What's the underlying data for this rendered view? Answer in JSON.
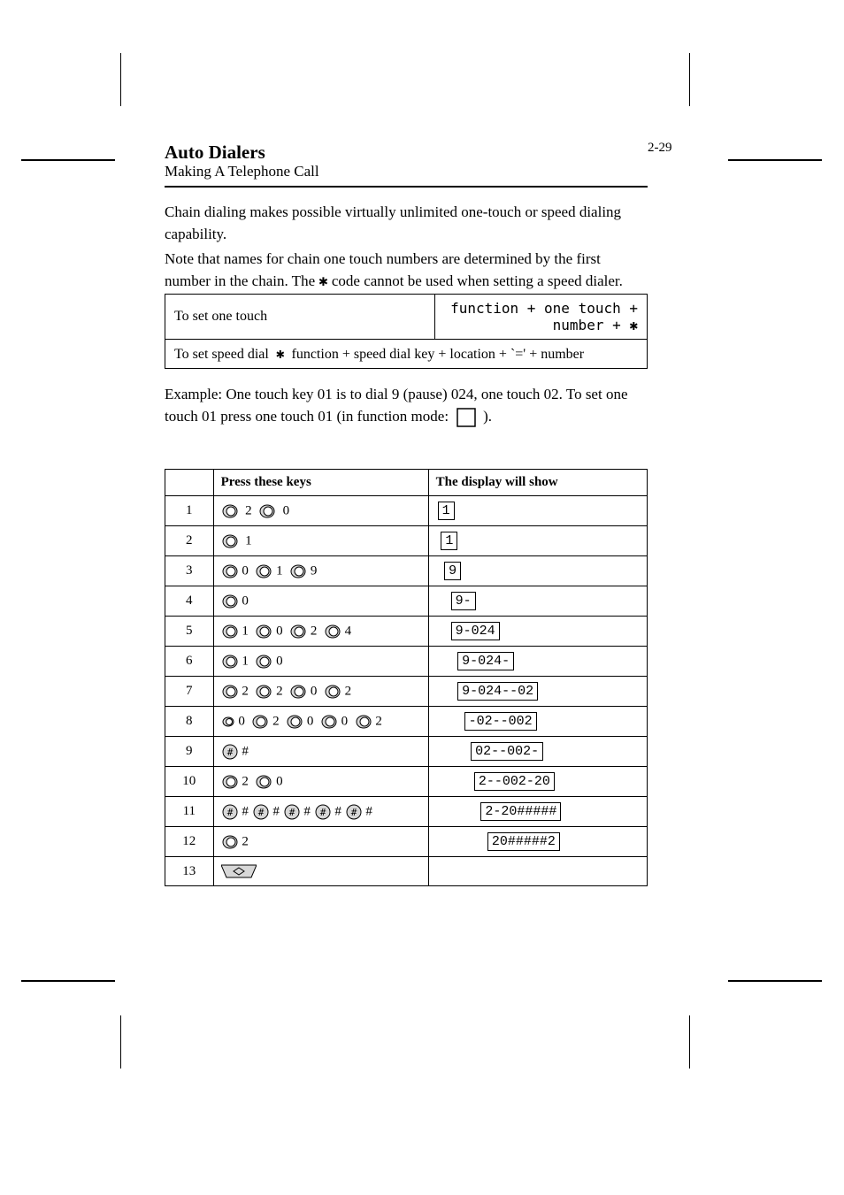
{
  "page_number": "2-29",
  "section": {
    "title": "Auto Dialers",
    "subtitle": "Making A Telephone Call"
  },
  "intro": {
    "p1": "Chain dialing makes possible virtually unlimited one-touch or speed dialing capability.",
    "p2_prefix": "Note that names for chain one touch numbers are determined by the first number in the chain. The ",
    "p2_star": "✱",
    "p2_suffix": " code cannot be used when setting a speed dialer."
  },
  "table1": {
    "r1c1": "To set one touch",
    "r1c2_prefix": "function + one touch + number + ",
    "r1c2_star": "✱",
    "r2c1_a": "To set speed dial",
    "r2c1_star": "✱",
    "r2c1_b": "function + speed dial key + location + `=' + number",
    "r2c2": ""
  },
  "example": {
    "p1": "Example: One touch key 01 is to dial 9 (pause) 024, one touch 02. To set one touch 01 press one touch 01 (in function mode:"
  },
  "box_symbol": "□",
  "table2": {
    "h1": "",
    "h2": "Press these keys",
    "h3": "The display will show",
    "rows": [
      {
        "n": "1",
        "keys": "2 0",
        "disp": "1",
        "pad": 0
      },
      {
        "n": "2",
        "keys": "1",
        "disp": "1",
        "pad": 1
      },
      {
        "n": "3",
        "keys": "0 1 9",
        "disp": "9",
        "pad": 2
      },
      {
        "n": "4",
        "keys": "0",
        "disp": "9-",
        "pad": 3
      },
      {
        "n": "5",
        "keys": "1 0 2 4",
        "disp": "9-024",
        "pad": 3
      },
      {
        "n": "6",
        "keys": "1 0",
        "disp": "9-024-",
        "pad": 4
      },
      {
        "n": "7",
        "keys": "2 2 0 2",
        "disp": "9-024--02",
        "pad": 4
      },
      {
        "n": "8",
        "keys": "0 2 0 0 2",
        "disp": "-02--002",
        "pad": 5
      },
      {
        "n": "9",
        "keys": "#",
        "disp": "02--002-",
        "pad": 6
      },
      {
        "n": "10",
        "keys": "2 0",
        "disp": "2--002-20",
        "pad": 6
      },
      {
        "n": "11",
        "keys": "# # # # #",
        "disp": "2-20#####",
        "pad": 7
      },
      {
        "n": "12",
        "keys": "2",
        "disp": "20#####2",
        "pad": 8
      },
      {
        "n": "13",
        "keys": "start",
        "disp": "",
        "pad": 0
      }
    ]
  }
}
